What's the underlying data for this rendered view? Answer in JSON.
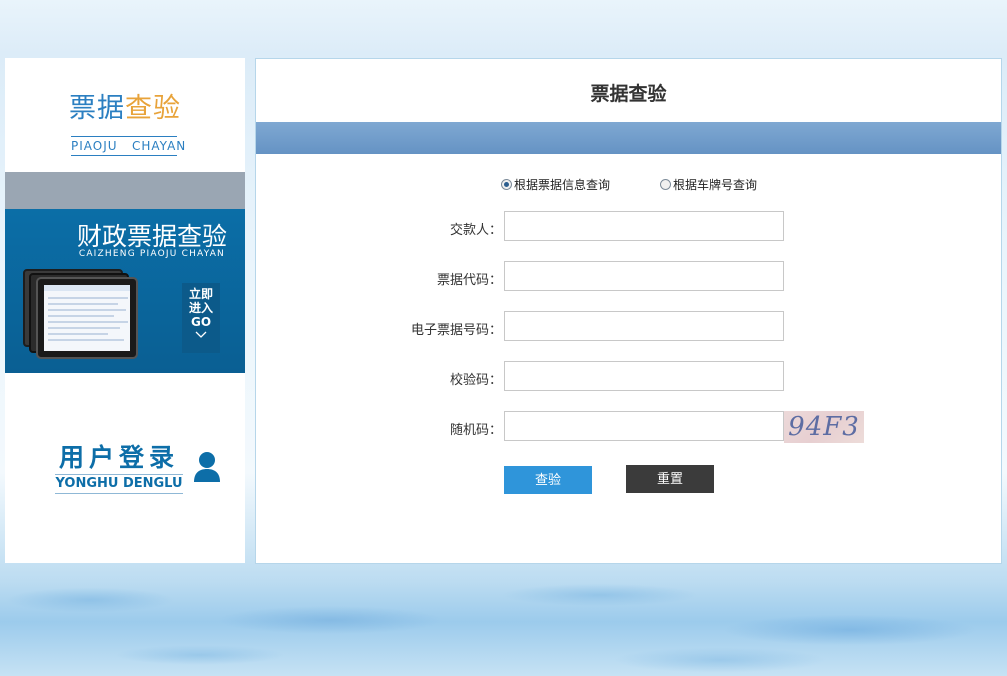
{
  "sidebar": {
    "logo_title_part1": "票据",
    "logo_title_part2": "查验",
    "logo_subtitle": "PIAOJU   CHAYAN",
    "banner_title": "财政票据查验",
    "banner_subtitle": "CAIZHENG PIAOJU CHAYAN",
    "go_line1": "立即",
    "go_line2": "进入",
    "go_line3": "GO",
    "login_title": "用户登录",
    "login_subtitle": "YONGHU DENGLU"
  },
  "main": {
    "title": "票据查验",
    "radio_options": [
      {
        "label": "根据票据信息查询",
        "checked": true
      },
      {
        "label": "根据车牌号查询",
        "checked": false
      }
    ],
    "fields": [
      {
        "label": "交款人：",
        "value": ""
      },
      {
        "label": "票据代码：",
        "value": ""
      },
      {
        "label": "电子票据号码：",
        "value": ""
      },
      {
        "label": "校验码：",
        "value": ""
      },
      {
        "label": "随机码：",
        "value": ""
      }
    ],
    "captcha_text": "94F3",
    "verify_button": "查验",
    "reset_button": "重置"
  },
  "colors": {
    "brand_blue": "#2b7fc1",
    "brand_orange": "#e8a33a",
    "banner_blue": "#0b6ea7",
    "primary_button": "#2f95da",
    "dark_button": "#3b3b3b"
  }
}
